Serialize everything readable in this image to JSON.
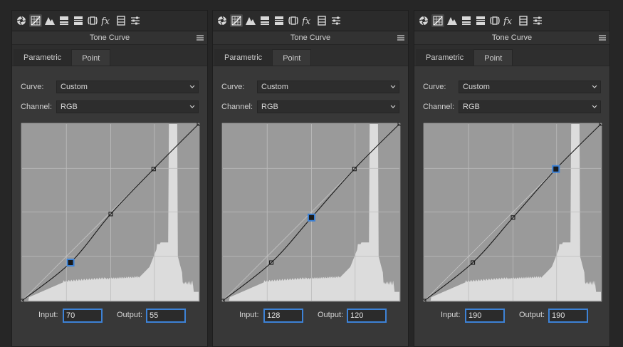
{
  "toolbar": {
    "icons": [
      "basic-aperture-icon",
      "tone-curve-grid-icon",
      "detail-mountains-icon",
      "hsl-icon",
      "split-toning-icon",
      "lens-corrections-icon",
      "effects-fx-icon",
      "camera-calibration-icon",
      "presets-sliders-icon"
    ]
  },
  "colors": {
    "accent": "#3d82d6",
    "curve_bg": "#9a9a9a",
    "histogram": "#dcdcdc"
  },
  "panels": [
    {
      "title": "Tone Curve",
      "tabs": [
        {
          "label": "Parametric"
        },
        {
          "label": "Point"
        }
      ],
      "active_tab": "Point",
      "curve_label": "Curve:",
      "curve_value": "Custom",
      "channel_label": "Channel:",
      "channel_value": "RGB",
      "input_label": "Input:",
      "input_value": "70",
      "output_label": "Output:",
      "output_value": "55",
      "points": [
        [
          0,
          0
        ],
        [
          70,
          55
        ],
        [
          128,
          125
        ],
        [
          190,
          190
        ],
        [
          255,
          255
        ]
      ],
      "selected": 1
    },
    {
      "title": "Tone Curve",
      "tabs": [
        {
          "label": "Parametric"
        },
        {
          "label": "Point"
        }
      ],
      "active_tab": "Point",
      "curve_label": "Curve:",
      "curve_value": "Custom",
      "channel_label": "Channel:",
      "channel_value": "RGB",
      "input_label": "Input:",
      "input_value": "128",
      "output_label": "Output:",
      "output_value": "120",
      "points": [
        [
          0,
          0
        ],
        [
          70,
          55
        ],
        [
          128,
          120
        ],
        [
          190,
          190
        ],
        [
          255,
          255
        ]
      ],
      "selected": 2
    },
    {
      "title": "Tone Curve",
      "tabs": [
        {
          "label": "Parametric"
        },
        {
          "label": "Point"
        }
      ],
      "active_tab": "Point",
      "curve_label": "Curve:",
      "curve_value": "Custom",
      "channel_label": "Channel:",
      "channel_value": "RGB",
      "input_label": "Input:",
      "input_value": "190",
      "output_label": "Output:",
      "output_value": "190",
      "points": [
        [
          0,
          0
        ],
        [
          70,
          55
        ],
        [
          128,
          120
        ],
        [
          190,
          190
        ],
        [
          255,
          255
        ]
      ],
      "selected": 3
    }
  ]
}
